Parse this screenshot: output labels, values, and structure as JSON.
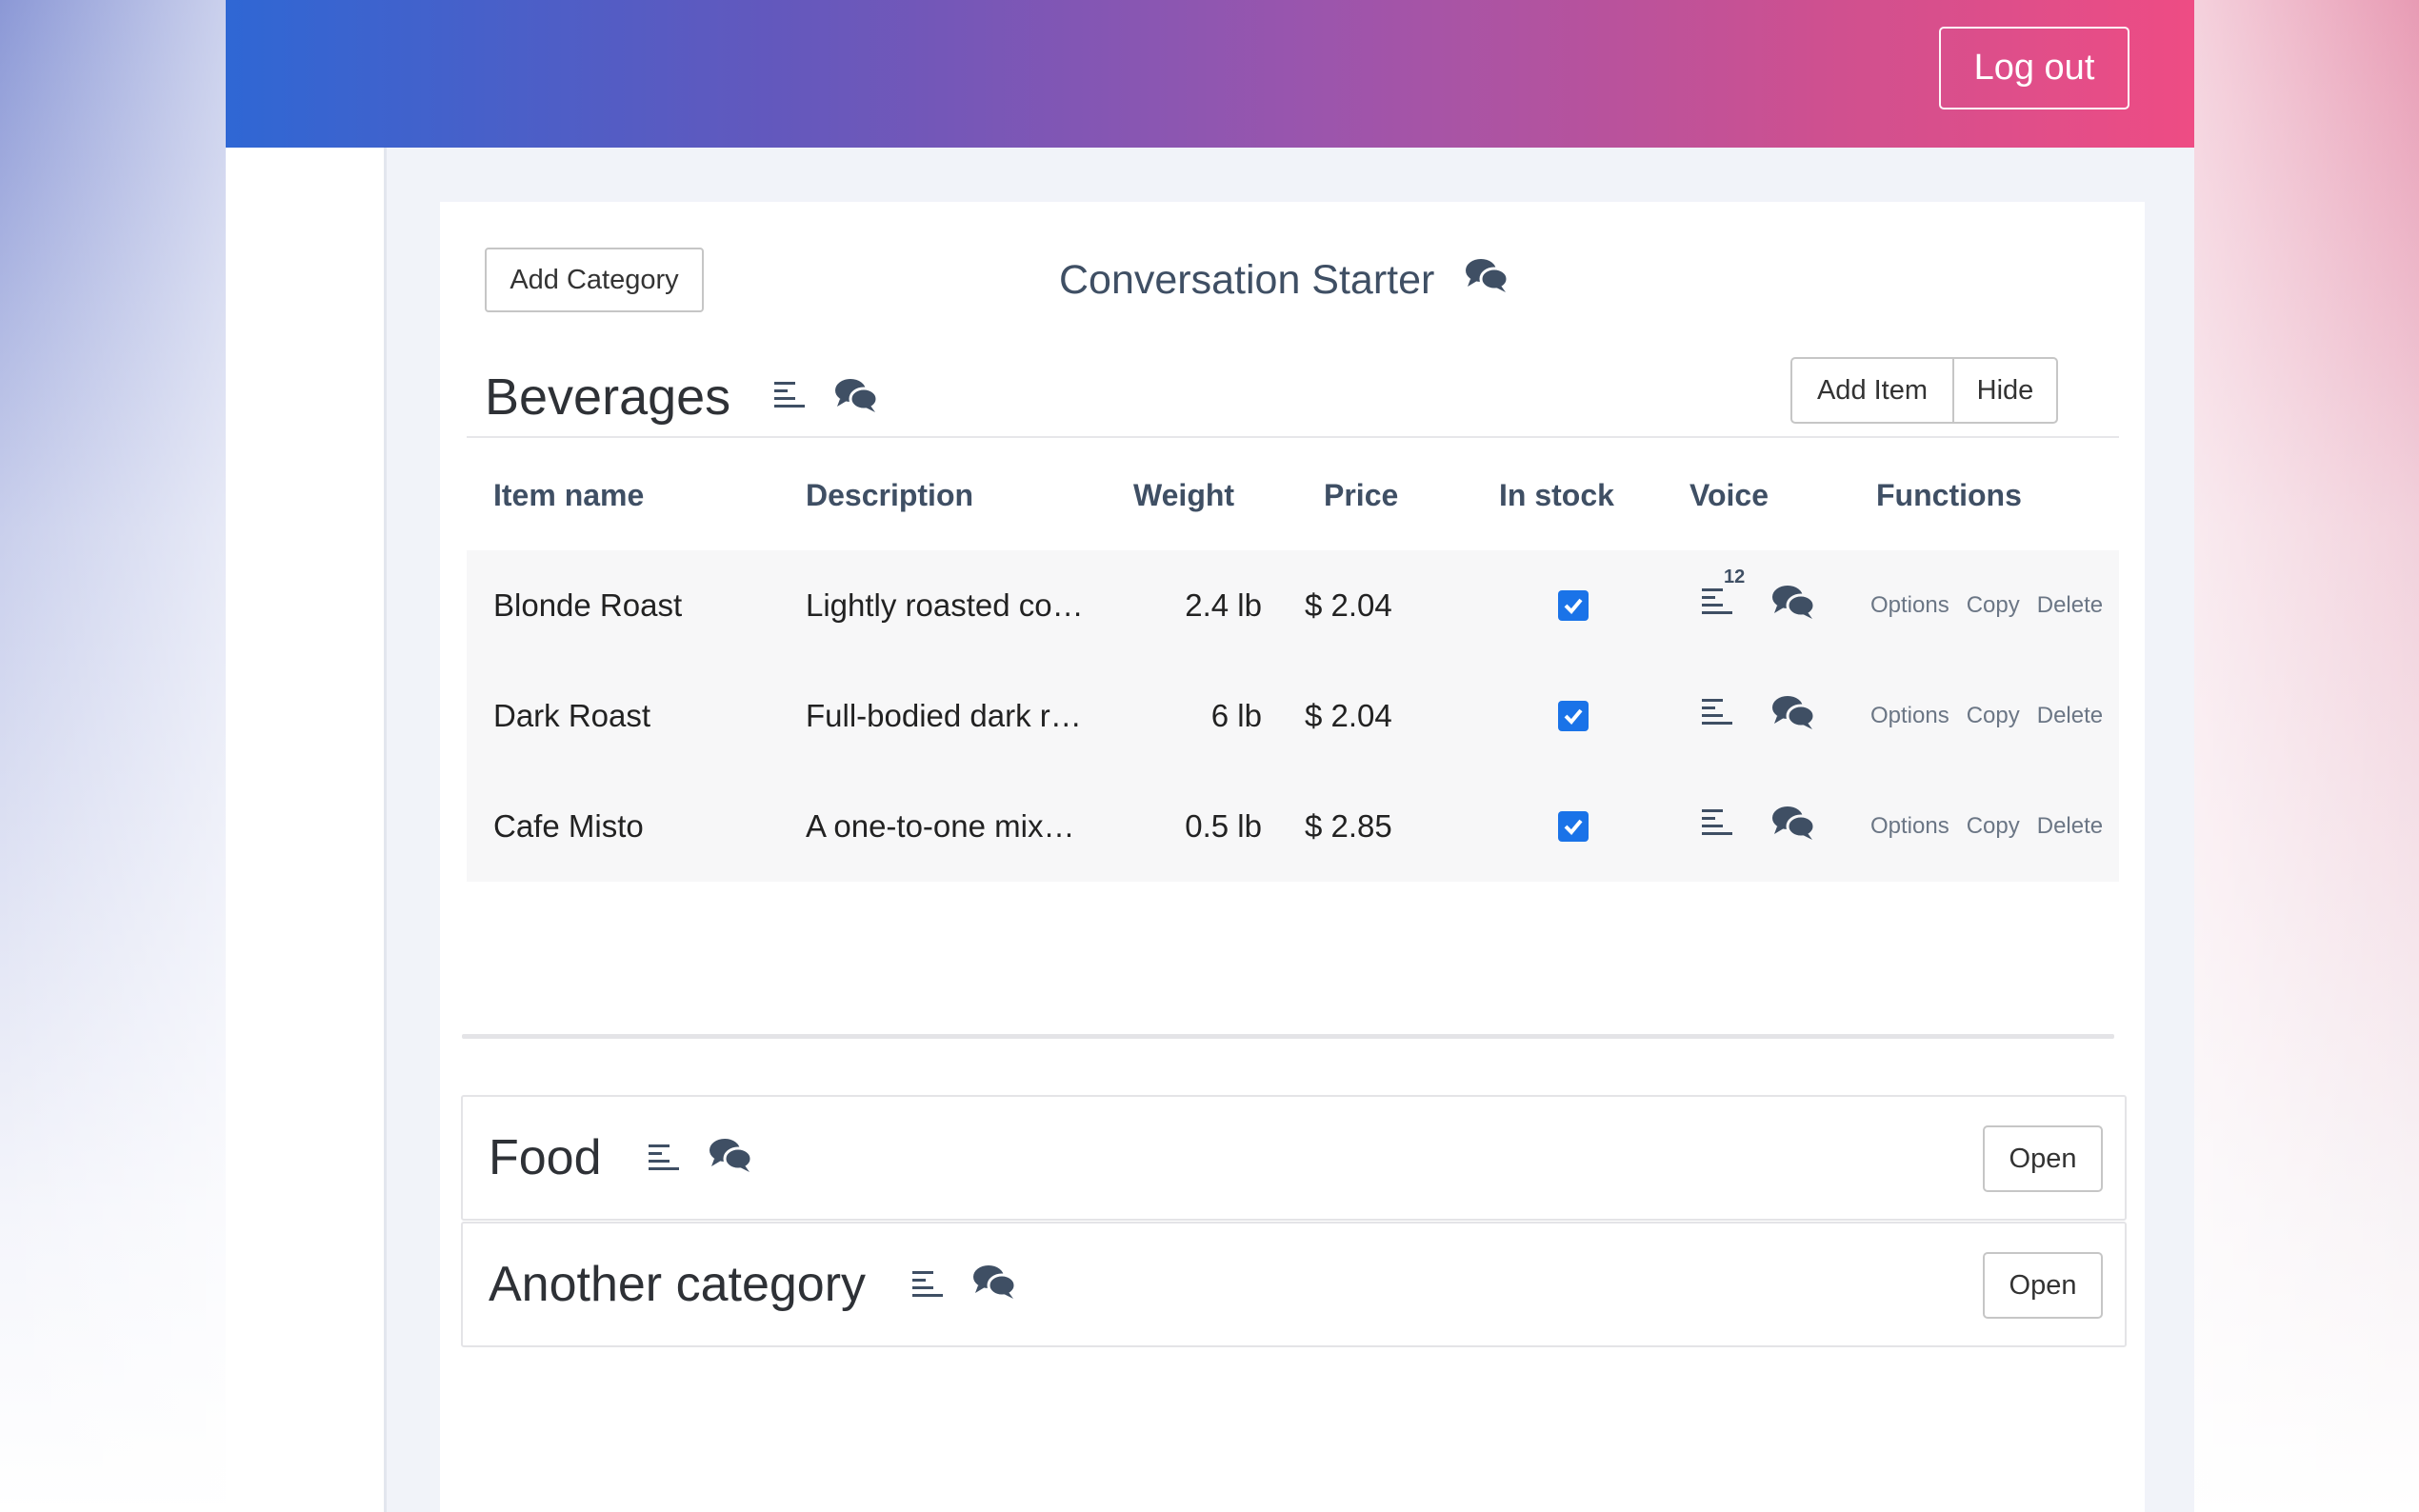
{
  "header": {
    "logout_label": "Log out"
  },
  "toolbar": {
    "add_category_label": "Add Category"
  },
  "conversation": {
    "title": "Conversation Starter"
  },
  "open_category": {
    "title": "Beverages",
    "add_item_label": "Add Item",
    "hide_label": "Hide",
    "columns": [
      "Item name",
      "Description",
      "Weight",
      "Price",
      "In stock",
      "Voice",
      "Functions"
    ],
    "rows": [
      {
        "name": "Blonde Roast",
        "description": "Lightly roasted co…",
        "weight": "2.4 lb",
        "price": "$ 2.04",
        "in_stock": true,
        "voice_count": "12"
      },
      {
        "name": "Dark Roast",
        "description": "Full-bodied dark r…",
        "weight": "6 lb",
        "price": "$ 2.04",
        "in_stock": true,
        "voice_count": ""
      },
      {
        "name": "Cafe Misto",
        "description": "A one-to-one mix…",
        "weight": "0.5 lb",
        "price": "$ 2.85",
        "in_stock": true,
        "voice_count": ""
      }
    ],
    "functions": {
      "options": "Options",
      "copy": "Copy",
      "delete": "Delete"
    }
  },
  "collapsed_categories": [
    {
      "title": "Food",
      "open_label": "Open"
    },
    {
      "title": "Another category",
      "open_label": "Open"
    }
  ],
  "icons": {
    "text_lines": "text-lines-icon",
    "chat": "chat-bubbles-icon",
    "check": "checkmark-icon"
  },
  "colors": {
    "header_gradient_start": "#2f67d4",
    "header_gradient_end": "#ee4c84",
    "checkbox": "#1a73e8",
    "icon": "#3f4f64"
  }
}
